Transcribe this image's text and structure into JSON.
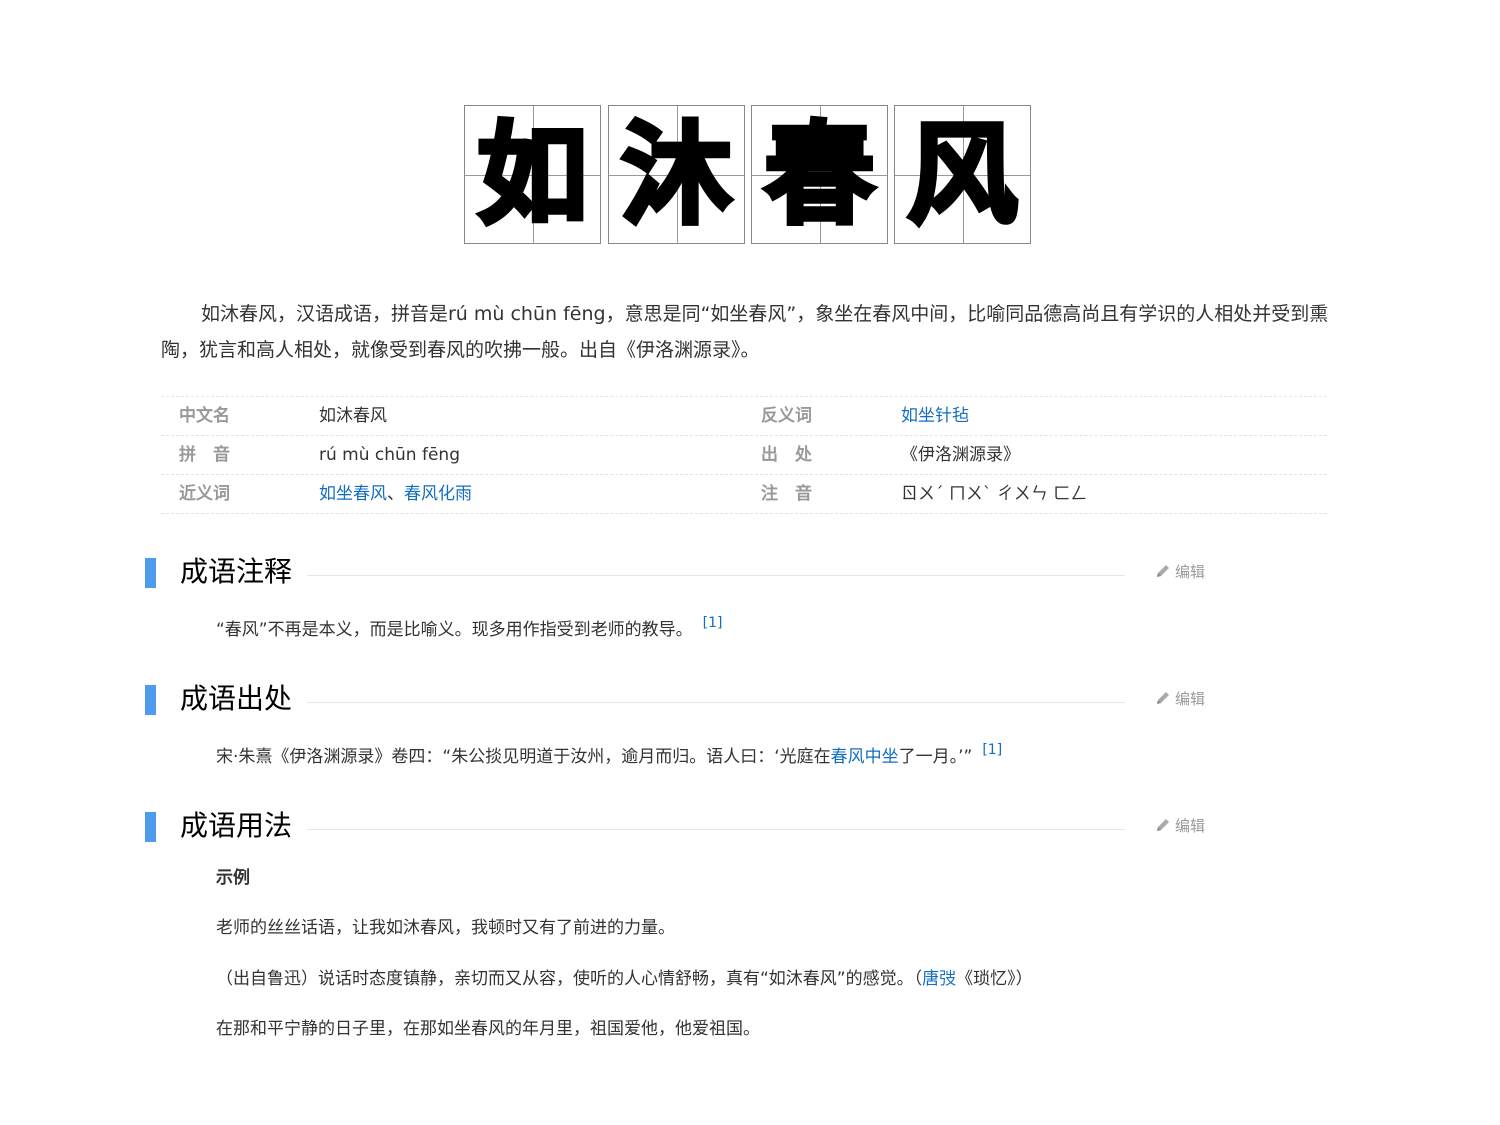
{
  "title": {
    "chars": [
      "如",
      "沐",
      "春",
      "风"
    ]
  },
  "intro": "如沐春风，汉语成语，拼音是rú mù chūn fēng，意思是同“如坐春风”，象坐在春风中间，比喻同品德高尚且有学识的人相处并受到熏陶，犹言和高人相处，就像受到春风的吹拂一般。出自《伊洛渊源录》。",
  "info": {
    "rows": [
      {
        "k1": "中文名",
        "v1": "如沐春风",
        "k2": "反义词",
        "v2": "如坐针毡"
      },
      {
        "k1": "拼　音",
        "v1": "rú mù chūn fēng",
        "k2": "出　处",
        "v2": "《伊洛渊源录》"
      },
      {
        "k1": "近义词",
        "v1a": "如坐春风",
        "v1sep": "、",
        "v1b": "春风化雨",
        "k2": "注　音",
        "v2": "ㄖㄨˊ ㄇㄨˋ ㄔㄨㄣ ㄈㄥ"
      }
    ]
  },
  "sections": {
    "explain": {
      "title": "成语注释",
      "edit": "编辑",
      "text": "“春风”不再是本义，而是比喻义。现多用作指受到老师的教导。",
      "ref": "[1]"
    },
    "origin": {
      "title": "成语出处",
      "edit": "编辑",
      "text_before": "宋·朱熹《伊洛渊源录》卷四：“朱公掞见明道于汝州，逾月而归。语人曰：‘光庭在",
      "link": "春风中坐",
      "text_after": "了一月。’”",
      "ref": "[1]"
    },
    "usage": {
      "title": "成语用法",
      "edit": "编辑",
      "subheading": "示例",
      "example1": "老师的丝丝话语，让我如沐春风，我顿时又有了前进的力量。",
      "example2_before": "（出自鲁迅）说话时态度镇静，亲切而又从容，使听的人心情舒畅，真有“如沐春风”的感觉。（",
      "example2_link": "唐弢",
      "example2_after": "《琐忆》）",
      "example3": "在那和平宁静的日子里，在那如坐春风的年月里，祖国爱他，他爱祖国。"
    }
  },
  "colors": {
    "accent_bar": "#4f9cee",
    "link": "#136ec2",
    "label_gray": "#999999"
  },
  "icons": {
    "edit": "pencil-icon"
  }
}
